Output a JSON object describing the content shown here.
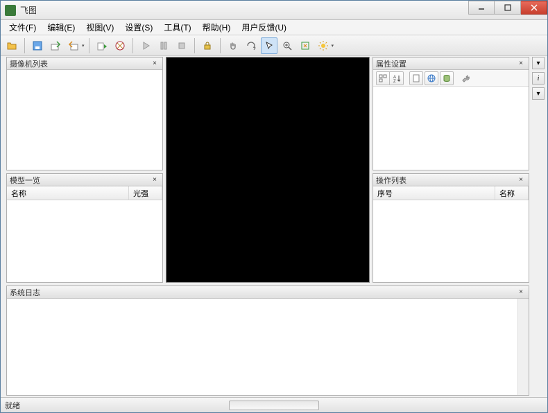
{
  "window": {
    "title": "飞图"
  },
  "menubar": {
    "file": "文件(F)",
    "edit": "编辑(E)",
    "view": "视图(V)",
    "settings": "设置(S)",
    "tools": "工具(T)",
    "help": "帮助(H)",
    "feedback": "用户反馈(U)"
  },
  "panels": {
    "camera_list": "摄像机列表",
    "model_list": "模型一览",
    "property_settings": "属性设置",
    "operation_list": "操作列表",
    "system_log": "系统日志"
  },
  "columns": {
    "name": "名称",
    "light_intensity": "光强",
    "index": "序号"
  },
  "statusbar": {
    "ready": "就绪"
  },
  "close_x": "×",
  "info_i": "i",
  "chevron": "▾"
}
